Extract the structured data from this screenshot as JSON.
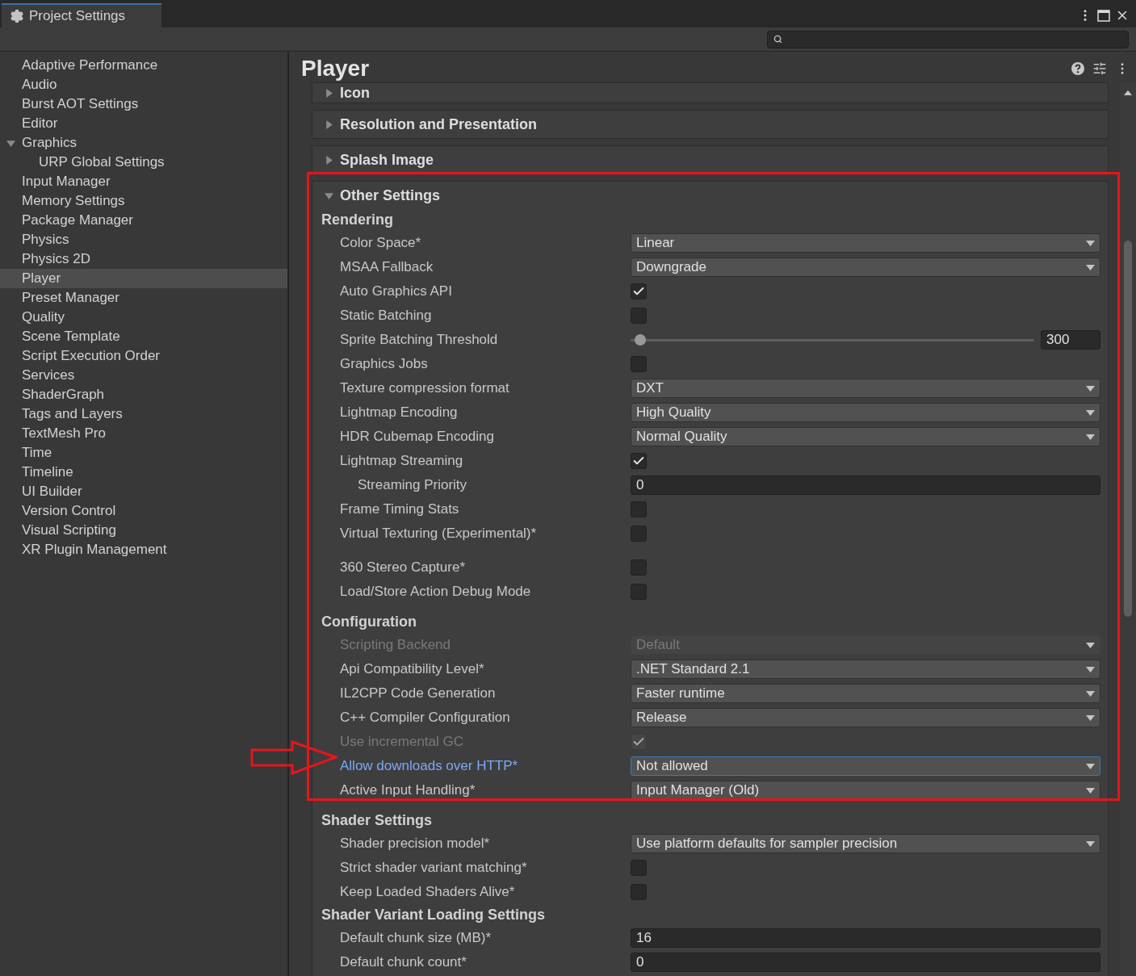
{
  "window": {
    "tab_title": "Project Settings"
  },
  "sidebar": {
    "items": [
      {
        "label": "Adaptive Performance",
        "selected": false
      },
      {
        "label": "Audio",
        "selected": false
      },
      {
        "label": "Burst AOT Settings",
        "selected": false
      },
      {
        "label": "Editor",
        "selected": false
      },
      {
        "label": "Graphics",
        "selected": false,
        "expanded": true,
        "children": [
          {
            "label": "URP Global Settings",
            "selected": false
          }
        ]
      },
      {
        "label": "Input Manager",
        "selected": false
      },
      {
        "label": "Memory Settings",
        "selected": false
      },
      {
        "label": "Package Manager",
        "selected": false
      },
      {
        "label": "Physics",
        "selected": false
      },
      {
        "label": "Physics 2D",
        "selected": false
      },
      {
        "label": "Player",
        "selected": true
      },
      {
        "label": "Preset Manager",
        "selected": false
      },
      {
        "label": "Quality",
        "selected": false
      },
      {
        "label": "Scene Template",
        "selected": false
      },
      {
        "label": "Script Execution Order",
        "selected": false
      },
      {
        "label": "Services",
        "selected": false
      },
      {
        "label": "ShaderGraph",
        "selected": false
      },
      {
        "label": "Tags and Layers",
        "selected": false
      },
      {
        "label": "TextMesh Pro",
        "selected": false
      },
      {
        "label": "Time",
        "selected": false
      },
      {
        "label": "Timeline",
        "selected": false
      },
      {
        "label": "UI Builder",
        "selected": false
      },
      {
        "label": "Version Control",
        "selected": false
      },
      {
        "label": "Visual Scripting",
        "selected": false
      },
      {
        "label": "XR Plugin Management",
        "selected": false
      }
    ]
  },
  "panel": {
    "title": "Player",
    "foldouts": [
      {
        "title": "Icon",
        "expanded": false
      },
      {
        "title": "Resolution and Presentation",
        "expanded": false
      },
      {
        "title": "Splash Image",
        "expanded": false
      },
      {
        "title": "Other Settings",
        "expanded": true,
        "groups": [
          {
            "title": "Rendering",
            "rows": [
              {
                "kind": "dropdown",
                "label": "Color Space*",
                "value": "Linear"
              },
              {
                "kind": "dropdown",
                "label": "MSAA Fallback",
                "value": "Downgrade"
              },
              {
                "kind": "checkbox",
                "label": "Auto Graphics API",
                "checked": true
              },
              {
                "kind": "checkbox",
                "label": "Static Batching",
                "checked": false
              },
              {
                "kind": "slider",
                "label": "Sprite Batching Threshold",
                "level": 0.01,
                "value": "300"
              },
              {
                "kind": "checkbox",
                "label": "Graphics Jobs",
                "checked": false
              },
              {
                "kind": "dropdown",
                "label": "Texture compression format",
                "value": "DXT"
              },
              {
                "kind": "dropdown",
                "label": "Lightmap Encoding",
                "value": "High Quality"
              },
              {
                "kind": "dropdown",
                "label": "HDR Cubemap Encoding",
                "value": "Normal Quality"
              },
              {
                "kind": "checkbox",
                "label": "Lightmap Streaming",
                "checked": true
              },
              {
                "kind": "number",
                "label": "Streaming Priority",
                "value": "0",
                "nested": true
              },
              {
                "kind": "checkbox",
                "label": "Frame Timing Stats",
                "checked": false
              },
              {
                "kind": "checkbox",
                "label": "Virtual Texturing (Experimental)*",
                "checked": false
              },
              {
                "kind": "checkbox",
                "label": "360 Stereo Capture*",
                "checked": false,
                "spaced": true
              },
              {
                "kind": "checkbox",
                "label": "Load/Store Action Debug Mode",
                "checked": false
              }
            ]
          },
          {
            "title": "Configuration",
            "rows": [
              {
                "kind": "dropdown",
                "label": "Scripting Backend",
                "value": "Default",
                "disabled": true
              },
              {
                "kind": "dropdown",
                "label": "Api Compatibility Level*",
                "value": ".NET Standard 2.1"
              },
              {
                "kind": "dropdown",
                "label": "IL2CPP Code Generation",
                "value": "Faster runtime"
              },
              {
                "kind": "dropdown",
                "label": "C++ Compiler Configuration",
                "value": "Release"
              },
              {
                "kind": "checkbox",
                "label": "Use incremental GC",
                "checked": true,
                "disabled": true
              },
              {
                "kind": "dropdown",
                "label": "Allow downloads over HTTP*",
                "value": "Not allowed",
                "focused": true
              },
              {
                "kind": "dropdown",
                "label": "Active Input Handling*",
                "value": "Input Manager (Old)"
              }
            ]
          },
          {
            "title": "Shader Settings",
            "rows": [
              {
                "kind": "dropdown",
                "label": "Shader precision model*",
                "value": "Use platform defaults for sampler precision"
              },
              {
                "kind": "checkbox",
                "label": "Strict shader variant matching*",
                "checked": false
              },
              {
                "kind": "checkbox",
                "label": "Keep Loaded Shaders Alive*",
                "checked": false
              }
            ]
          },
          {
            "title": "Shader Variant Loading Settings",
            "tight": true,
            "rows": [
              {
                "kind": "number",
                "label": "Default chunk size (MB)*",
                "value": "16"
              },
              {
                "kind": "number",
                "label": "Default chunk count*",
                "value": "0"
              }
            ]
          }
        ]
      }
    ]
  }
}
